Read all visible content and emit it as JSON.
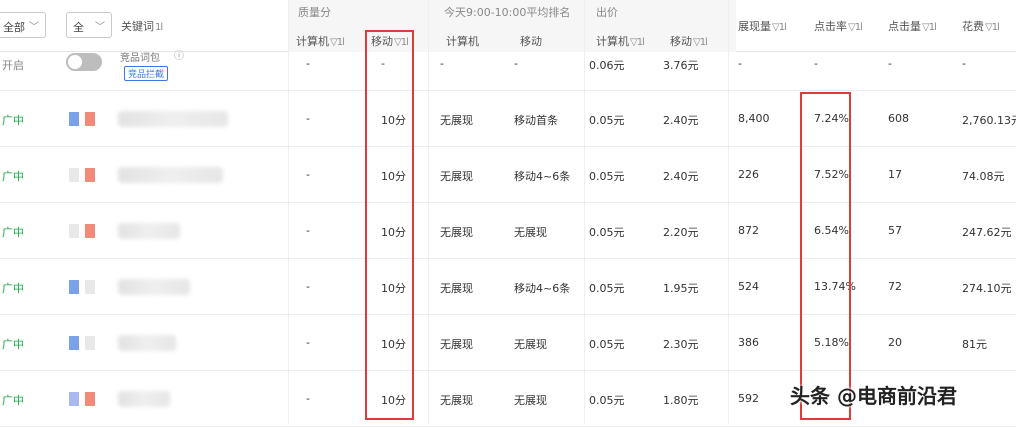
{
  "filters": {
    "status_select": "全部",
    "match_select": "全",
    "keyword_header": "关键词",
    "keyword_sort": "1l"
  },
  "groups": {
    "quality": "质量分",
    "rank": "今天9:00-10:00平均排名",
    "bid": "出价"
  },
  "columns": {
    "q_pc": "计算机",
    "q_mobile": "移动",
    "r_pc": "计算机",
    "r_mobile": "移动",
    "b_pc": "计算机",
    "b_mobile": "移动",
    "impressions": "展现量",
    "ctr": "点击率",
    "clicks": "点击量",
    "cost": "花费",
    "sort_symbol": "▽1l"
  },
  "first_row": {
    "status": "开启",
    "keyword_partial": "竞品词包",
    "tag": "竞品拦截",
    "q_pc": "-",
    "q_mobile": "-",
    "r_pc": "-",
    "r_mobile": "-",
    "b_pc": "0.06元",
    "b_mobile": "3.76元",
    "impressions": "-",
    "ctr": "-",
    "clicks": "-",
    "cost": "-"
  },
  "rows": [
    {
      "status": "广中",
      "q_pc": "-",
      "q_mobile": "10分",
      "r_pc": "无展现",
      "r_mobile": "移动首条",
      "b_pc": "0.05元",
      "b_mobile": "2.40元",
      "impressions": "8,400",
      "ctr": "7.24%",
      "clicks": "608",
      "cost": "2,760.13元",
      "flags": [
        "#7ba1e8",
        "#f08a7a"
      ]
    },
    {
      "status": "广中",
      "q_pc": "-",
      "q_mobile": "10分",
      "r_pc": "无展现",
      "r_mobile": "移动4~6条",
      "b_pc": "0.05元",
      "b_mobile": "2.40元",
      "impressions": "226",
      "ctr": "7.52%",
      "clicks": "17",
      "cost": "74.08元",
      "flags": [
        "#e8e8e8",
        "#f08a7a"
      ]
    },
    {
      "status": "广中",
      "q_pc": "-",
      "q_mobile": "10分",
      "r_pc": "无展现",
      "r_mobile": "无展现",
      "b_pc": "0.05元",
      "b_mobile": "2.20元",
      "impressions": "872",
      "ctr": "6.54%",
      "clicks": "57",
      "cost": "247.62元",
      "flags": [
        "#e8e8e8",
        "#f08a7a"
      ]
    },
    {
      "status": "广中",
      "q_pc": "-",
      "q_mobile": "10分",
      "r_pc": "无展现",
      "r_mobile": "移动4~6条",
      "b_pc": "0.05元",
      "b_mobile": "1.95元",
      "impressions": "524",
      "ctr": "13.74%",
      "clicks": "72",
      "cost": "274.10元",
      "flags": [
        "#7ba1e8",
        "#e8e8e8"
      ]
    },
    {
      "status": "广中",
      "q_pc": "-",
      "q_mobile": "10分",
      "r_pc": "无展现",
      "r_mobile": "无展现",
      "b_pc": "0.05元",
      "b_mobile": "2.30元",
      "impressions": "386",
      "ctr": "5.18%",
      "clicks": "20",
      "cost": "81元",
      "flags": [
        "#7ba1e8",
        "#e8e8e8"
      ]
    },
    {
      "status": "广中",
      "q_pc": "-",
      "q_mobile": "10分",
      "r_pc": "无展现",
      "r_mobile": "无展现",
      "b_pc": "0.05元",
      "b_mobile": "1.80元",
      "impressions": "592",
      "ctr": "",
      "clicks": "",
      "cost": "",
      "flags": [
        "#a9b9ef",
        "#f08a7a"
      ]
    }
  ],
  "colors": {
    "status_green": "#1aa548",
    "highlight_red": "#e03a3a",
    "tag_blue": "#3b78e7"
  },
  "watermark": "头条 @电商前沿君"
}
